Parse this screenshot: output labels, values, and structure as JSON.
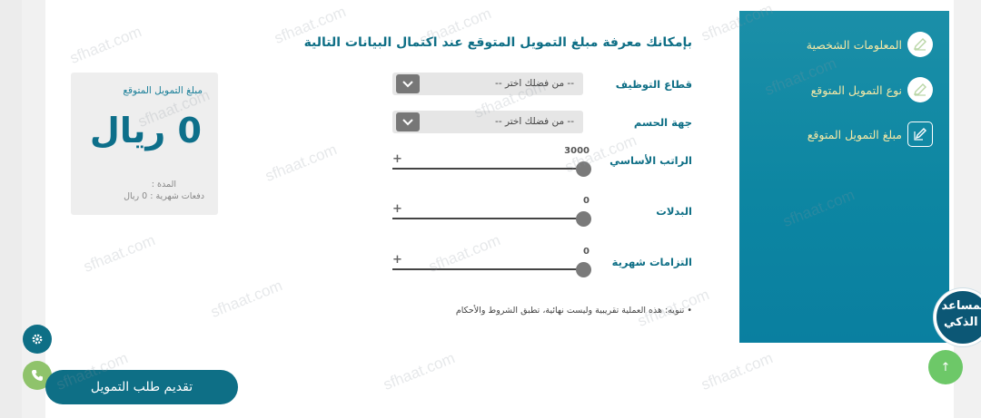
{
  "header": {
    "title": "بإمكانك معرفة مبلغ التمويل المتوقع عند اكتمال البيانات التالية"
  },
  "form": {
    "employment_sector": {
      "label": "قطاع التوظيف",
      "placeholder": "-- من فضلك اختر --"
    },
    "military_entity": {
      "label": "جهة الحسم",
      "placeholder": "-- من فضلك اختر --"
    },
    "basic_salary": {
      "label": "الراتب الأساسي",
      "value": "3000",
      "plus": "+"
    },
    "allowances": {
      "label": "البدلات",
      "value": "0",
      "plus": "+"
    },
    "monthly_obligations": {
      "label": "التزامات شهرية",
      "value": "0",
      "plus": "+"
    },
    "note": "• تنويه: هذه العملية تقريبية وليست نهائية، تطبق الشروط والأحكام"
  },
  "result": {
    "title": "مبلغ التمويل المتوقع",
    "amount": "0 ريال",
    "duration_label": "المدة :",
    "payments_label": "دفعات شهرية : 0 ريال"
  },
  "steps": [
    {
      "label": "المعلومات الشخصية",
      "icon": "edit-icon"
    },
    {
      "label": "نوع التمويل المتوقع",
      "icon": "edit-icon"
    },
    {
      "label": "مبلغ التمويل المتوقع",
      "icon": "edit-icon"
    }
  ],
  "actions": {
    "submit_label": "تقديم طلب التمويل",
    "assistant_label": "المساعد الذكي",
    "up_arrow": "↑"
  },
  "watermark": "sfhaat.com",
  "colors": {
    "primary": "#0e6f86",
    "panel": "#0d86a2",
    "step_text": "#f3e8a6",
    "green": "#8fc36b"
  }
}
